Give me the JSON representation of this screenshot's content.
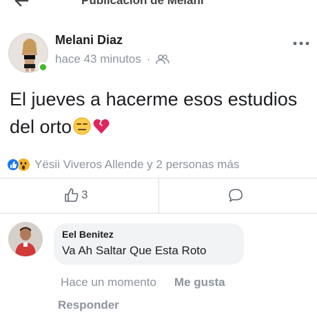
{
  "header": {
    "title": "Publicación de Melani"
  },
  "post": {
    "author": "Melani Diaz",
    "time": "hace 43 minutos",
    "separator": "·",
    "text": "El jueves a hacerme esos estudios del orto",
    "emojis": [
      "expressionless-face",
      "broken-heart"
    ],
    "reactions_text": "Yësii Viveros Allende y 2 personas más",
    "reaction_icons": [
      "like",
      "wow"
    ],
    "like_count": "3",
    "online": true,
    "colors": {
      "online": "#42b72a",
      "like": "#1877f2",
      "wow": "#f7b125",
      "broken_heart": "#e0245e"
    }
  },
  "comment": {
    "author": "Eel Benitez",
    "text": "Va Ah Saltar Que Esta Roto",
    "time": "Hace un momento",
    "like_label": "Me gusta",
    "reply_label": "Responder"
  }
}
